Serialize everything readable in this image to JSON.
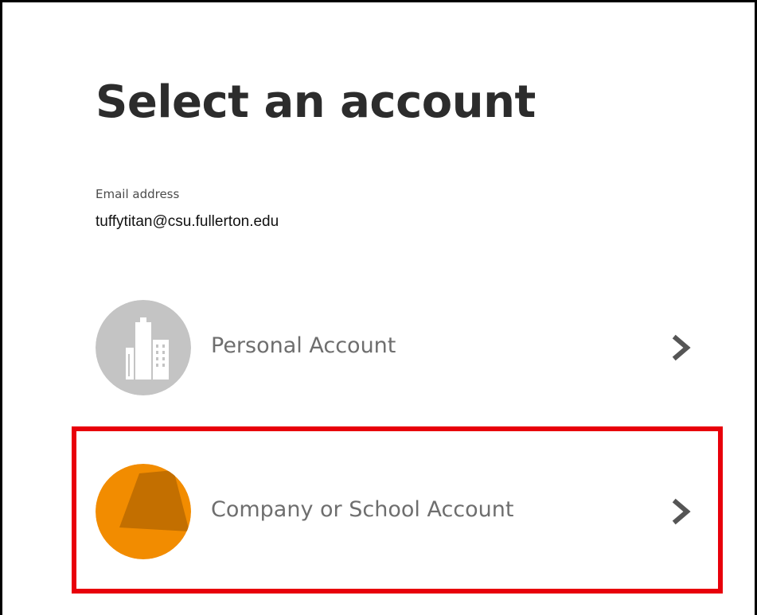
{
  "page": {
    "title": "Select an account"
  },
  "email": {
    "label": "Email address",
    "value": "tuffytitan@csu.fullerton.edu"
  },
  "accounts": [
    {
      "label": "Personal Account",
      "icon": "building-icon",
      "avatar_color": "#c4c4c4"
    },
    {
      "label": "Company or School Account",
      "icon": "school-account-icon",
      "avatar_color": "#f28c00",
      "highlighted": true
    }
  ],
  "colors": {
    "highlight": "#e8000b",
    "chevron": "#555555",
    "title": "#2c2c2c"
  }
}
